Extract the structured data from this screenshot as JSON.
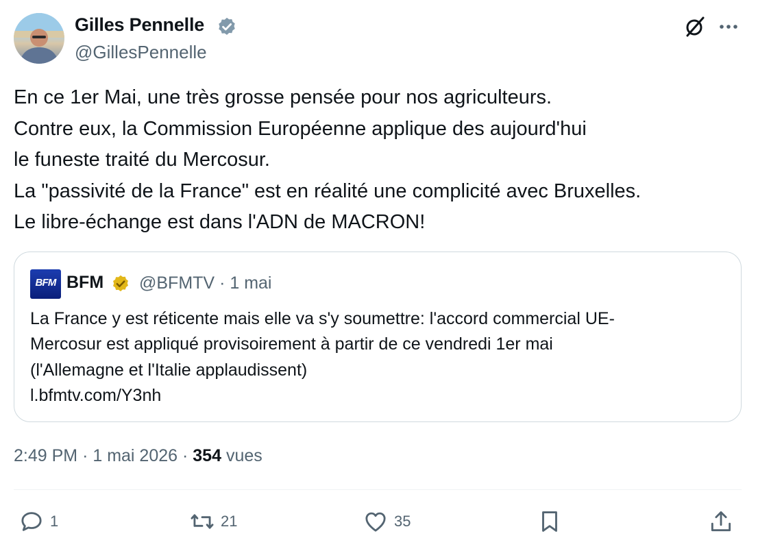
{
  "author": {
    "name": "Gilles Pennelle",
    "handle": "@GillesPennelle"
  },
  "tweet": {
    "lines": [
      "En ce 1er Mai, une très grosse pensée pour nos agriculteurs.",
      "Contre eux, la Commission Européenne applique des aujourd'hui",
      "le funeste traité du Mercosur.",
      "La \"passivité de la France\" est en réalité une complicité avec Bruxelles.",
      "Le libre-échange est dans l'ADN de MACRON!"
    ]
  },
  "quote": {
    "logo_text": "BFM",
    "name": "BFM",
    "handle": "@BFMTV",
    "separator": "·",
    "date": "1 mai",
    "lines": [
      "La France y est réticente mais elle va s'y soumettre: l'accord commercial UE-",
      "Mercosur est appliqué provisoirement à partir de ce vendredi 1er mai",
      "(l'Allemagne et l'Italie applaudissent)",
      "l.bfmtv.com/Y3nh"
    ]
  },
  "meta": {
    "time": "2:49 PM",
    "separator": "·",
    "date": "1 mai 2026",
    "views_count": "354",
    "views_label": "vues"
  },
  "actions": {
    "replies": "1",
    "retweets": "21",
    "likes": "35"
  },
  "icons": {
    "verified": "verified-badge-icon",
    "quote_verified": "gold-verified-badge-icon",
    "grok": "grok-icon",
    "more": "more-icon",
    "reply": "reply-icon",
    "retweet": "retweet-icon",
    "like": "heart-icon",
    "bookmark": "bookmark-icon",
    "share": "share-icon"
  },
  "colors": {
    "text": "#0f1419",
    "secondary": "#536471",
    "verified_blue": "#829aab",
    "verified_gold": "#e2b719",
    "border": "#cfd9de",
    "bfm_blue": "#1c3db0"
  }
}
